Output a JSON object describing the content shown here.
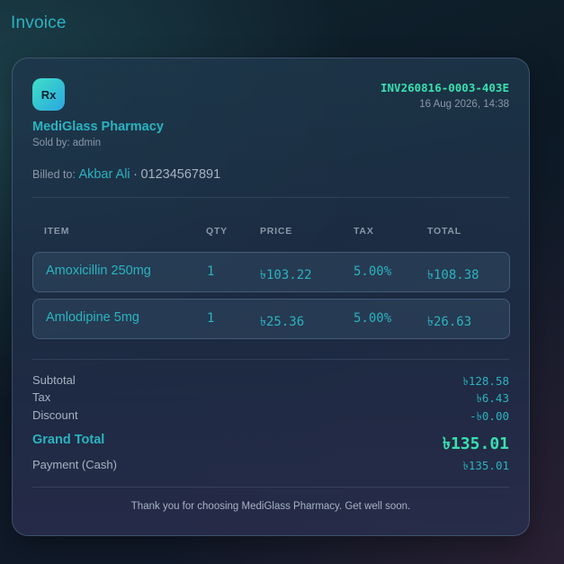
{
  "page": {
    "title": "Invoice"
  },
  "pharmacy": {
    "logo_text": "Rx",
    "name": "MediGlass Pharmacy",
    "sold_by": "Sold by: admin"
  },
  "invoice": {
    "id": "INV260816-0003-403E",
    "datetime": "16 Aug 2026, 14:38"
  },
  "billed_to": {
    "label": "Billed to:",
    "name": "Akbar Ali",
    "separator": "·",
    "phone": "01234567891"
  },
  "table": {
    "headers": [
      "ITEM",
      "QTY",
      "PRICE",
      "TAX",
      "TOTAL"
    ],
    "rows": [
      {
        "item": "Amoxicillin 250mg",
        "qty": "1",
        "price": "৳103.22",
        "tax": "5.00%",
        "total": "৳108.38"
      },
      {
        "item": "Amlodipine 5mg",
        "qty": "1",
        "price": "৳25.36",
        "tax": "5.00%",
        "total": "৳26.63"
      }
    ]
  },
  "summary": {
    "subtotal_label": "Subtotal",
    "subtotal": "৳128.58",
    "tax_label": "Tax",
    "tax": "৳6.43",
    "discount_label": "Discount",
    "discount": "-৳0.00",
    "grand_total_label": "Grand Total",
    "grand_total": "৳135.01",
    "payment_label": "Payment (Cash)",
    "payment": "৳135.01"
  },
  "footer": {
    "thanks": "Thank you for choosing MediGlass Pharmacy. Get well soon."
  },
  "colors": {
    "accent": "#2bb3c0",
    "highlight": "#39e0b0",
    "muted": "#8a97a8"
  }
}
